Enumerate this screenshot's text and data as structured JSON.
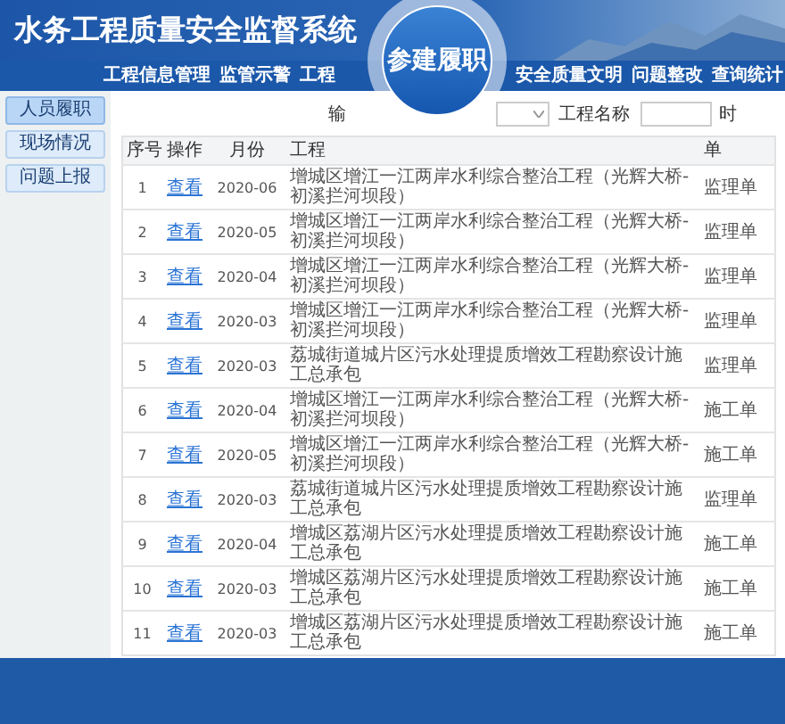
{
  "header": {
    "title": "水务工程质量安全监督系统"
  },
  "nav": [
    {
      "label": "工程信息管理"
    },
    {
      "label": "监管示警"
    },
    {
      "label": "工程"
    },
    {
      "label": "安全质量文明"
    },
    {
      "label": "问题整改"
    },
    {
      "label": "查询统计"
    }
  ],
  "feature_badge": {
    "label": "参建履职"
  },
  "sidebar": {
    "items": [
      {
        "label": "人员履职",
        "selected": true
      },
      {
        "label": "现场情况",
        "selected": false
      },
      {
        "label": "问题上报",
        "selected": false
      }
    ]
  },
  "filter": {
    "label_1": "输",
    "label_2": "工程名称",
    "label_3": "时"
  },
  "table": {
    "columns": [
      "序号",
      "操作",
      "月份",
      "工程",
      "单"
    ],
    "rows": [
      {
        "no": "1",
        "action": "查看",
        "month": "2020-06",
        "project": "增城区增江一江两岸水利综合整治工程（光辉大桥-初溪拦河坝段）",
        "unit": "监理单"
      },
      {
        "no": "2",
        "action": "查看",
        "month": "2020-05",
        "project": "增城区增江一江两岸水利综合整治工程（光辉大桥-初溪拦河坝段）",
        "unit": "监理单"
      },
      {
        "no": "3",
        "action": "查看",
        "month": "2020-04",
        "project": "增城区增江一江两岸水利综合整治工程（光辉大桥-初溪拦河坝段）",
        "unit": "监理单"
      },
      {
        "no": "4",
        "action": "查看",
        "month": "2020-03",
        "project": "增城区增江一江两岸水利综合整治工程（光辉大桥-初溪拦河坝段）",
        "unit": "监理单"
      },
      {
        "no": "5",
        "action": "查看",
        "month": "2020-03",
        "project": "荔城街道城片区污水处理提质增效工程勘察设计施工总承包",
        "unit": "监理单"
      },
      {
        "no": "6",
        "action": "查看",
        "month": "2020-04",
        "project": "增城区增江一江两岸水利综合整治工程（光辉大桥-初溪拦河坝段）",
        "unit": "施工单"
      },
      {
        "no": "7",
        "action": "查看",
        "month": "2020-05",
        "project": "增城区增江一江两岸水利综合整治工程（光辉大桥-初溪拦河坝段）",
        "unit": "施工单"
      },
      {
        "no": "8",
        "action": "查看",
        "month": "2020-03",
        "project": "荔城街道城片区污水处理提质增效工程勘察设计施工总承包",
        "unit": "监理单"
      },
      {
        "no": "9",
        "action": "查看",
        "month": "2020-04",
        "project": "增城区荔湖片区污水处理提质增效工程勘察设计施工总承包",
        "unit": "施工单"
      },
      {
        "no": "10",
        "action": "查看",
        "month": "2020-03",
        "project": "增城区荔湖片区污水处理提质增效工程勘察设计施工总承包",
        "unit": "施工单"
      },
      {
        "no": "11",
        "action": "查看",
        "month": "2020-03",
        "project": "增城区荔湖片区污水处理提质增效工程勘察设计施工总承包",
        "unit": "施工单"
      }
    ]
  }
}
